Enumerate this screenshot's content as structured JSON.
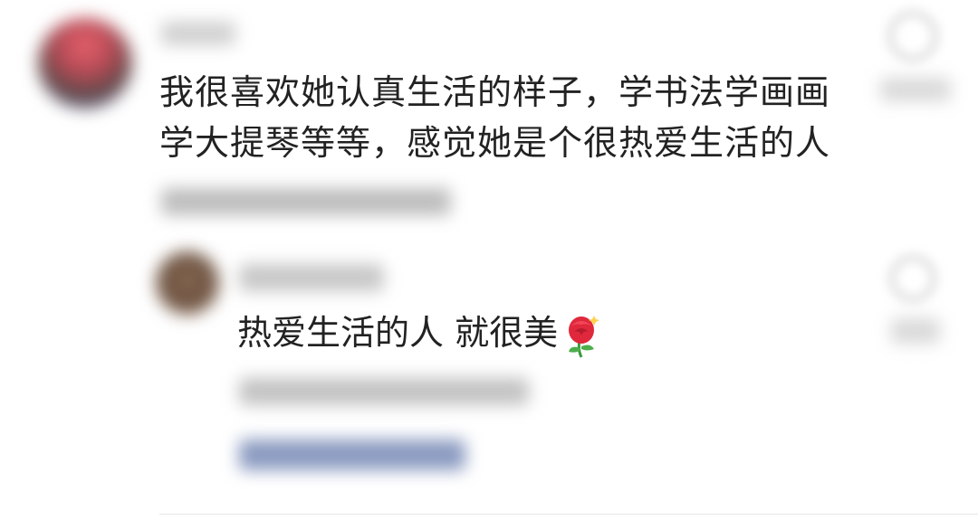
{
  "comment": {
    "text": "我很喜欢她认真生活的样子，学书法学画画学大提琴等等，感觉她是个很热爱生活的人"
  },
  "reply": {
    "text": "热爱生活的人 就很美",
    "emoji": "rose-icon"
  },
  "colors": {
    "text": "#222222",
    "background": "#ffffff",
    "link": "#8a9ac0"
  }
}
